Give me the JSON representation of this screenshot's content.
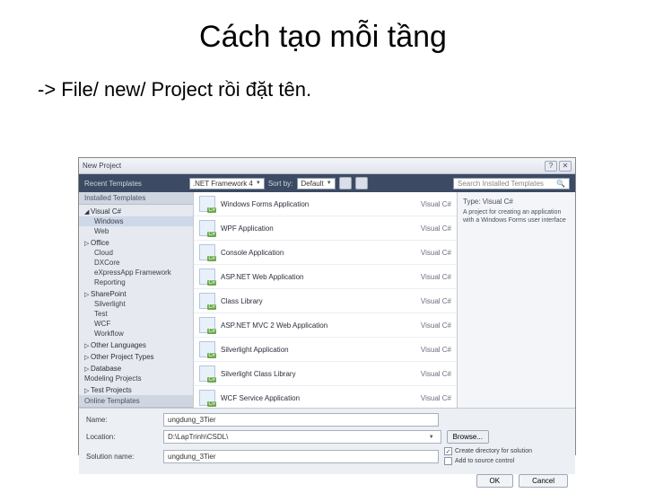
{
  "slide": {
    "title": "Cách tạo mỗi tầng",
    "text": "-> File/ new/ Project rồi đặt tên."
  },
  "dialog": {
    "title": "New Project",
    "toolbar": {
      "recent_label": "Recent Templates",
      "framework": ".NET Framework 4",
      "sort_label": "Sort by:",
      "sort_value": "Default",
      "search_placeholder": "Search Installed Templates"
    },
    "sidebar": {
      "header": "Installed Templates",
      "group": "Visual C#",
      "items": [
        "Windows",
        "Web",
        "Office",
        "Cloud",
        "DXCore",
        "eXpressApp Framework",
        "Reporting",
        "SharePoint",
        "Silverlight",
        "Test",
        "WCF",
        "Workflow"
      ],
      "other": [
        "Other Languages",
        "Other Project Types",
        "Database",
        "Modeling Projects",
        "Test Projects"
      ],
      "online": "Online Templates"
    },
    "templates": [
      {
        "name": "Windows Forms Application",
        "lang": "Visual C#"
      },
      {
        "name": "WPF Application",
        "lang": "Visual C#"
      },
      {
        "name": "Console Application",
        "lang": "Visual C#"
      },
      {
        "name": "ASP.NET Web Application",
        "lang": "Visual C#"
      },
      {
        "name": "Class Library",
        "lang": "Visual C#"
      },
      {
        "name": "ASP.NET MVC 2 Web Application",
        "lang": "Visual C#"
      },
      {
        "name": "Silverlight Application",
        "lang": "Visual C#"
      },
      {
        "name": "Silverlight Class Library",
        "lang": "Visual C#"
      },
      {
        "name": "WCF Service Application",
        "lang": "Visual C#"
      }
    ],
    "desc": {
      "type_label": "Type: Visual C#",
      "text": "A project for creating an application with a Windows Forms user interface"
    },
    "bottom": {
      "name_label": "Name:",
      "name_value": "ungdung_3Tier",
      "location_label": "Location:",
      "location_value": "D:\\LapTrinh\\CSDL\\",
      "browse": "Browse...",
      "solution_label": "Solution name:",
      "solution_value": "ungdung_3Tier",
      "check1": "Create directory for solution",
      "check2": "Add to source control"
    },
    "footer": {
      "ok": "OK",
      "cancel": "Cancel"
    }
  }
}
